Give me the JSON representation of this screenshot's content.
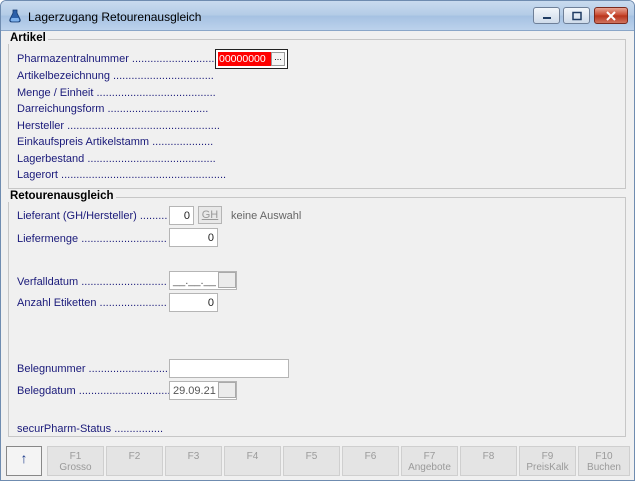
{
  "window": {
    "title": "Lagerzugang Retourenausgleich"
  },
  "artikel": {
    "group_title": "Artikel",
    "pzn_label": "Pharmazentralnummer ..............................",
    "pzn_value": "00000000",
    "pzn_button": "...",
    "labels": [
      "Artikelbezeichnung .................................",
      "Menge / Einheit .......................................",
      "Darreichungsform .................................",
      "Hersteller ..................................................",
      "Einkaufspreis Artikelstamm ....................",
      "Lagerbestand ..........................................",
      "Lagerort ......................................................"
    ]
  },
  "retoure": {
    "group_title": "Retourenausgleich",
    "lieferant_label": "Lieferant (GH/Hersteller) .........",
    "lieferant_value": "0",
    "gh_button": "GH",
    "lieferant_info": "keine Auswahl",
    "liefermenge_label": "Liefermenge ............................",
    "liefermenge_value": "0",
    "verfall_label": "Verfalldatum ............................",
    "verfall_value": "__.__.__",
    "etiketten_label": "Anzahl Etiketten ......................",
    "etiketten_value": "0",
    "belegnr_label": "Belegnummer ...........................",
    "belegnr_value": "",
    "belegdatum_label": "Belegdatum ..............................",
    "belegdatum_value": "29.09.21",
    "securpharm_label": "securPharm-Status ................"
  },
  "fkeys": [
    {
      "key": "↑",
      "label": ""
    },
    {
      "key": "F1",
      "label": "Grosso"
    },
    {
      "key": "F2",
      "label": ""
    },
    {
      "key": "F3",
      "label": ""
    },
    {
      "key": "F4",
      "label": ""
    },
    {
      "key": "F5",
      "label": ""
    },
    {
      "key": "F6",
      "label": ""
    },
    {
      "key": "F7",
      "label": "Angebote"
    },
    {
      "key": "F8",
      "label": ""
    },
    {
      "key": "F9",
      "label": "PreisKalk"
    },
    {
      "key": "F10",
      "label": "Buchen"
    }
  ]
}
